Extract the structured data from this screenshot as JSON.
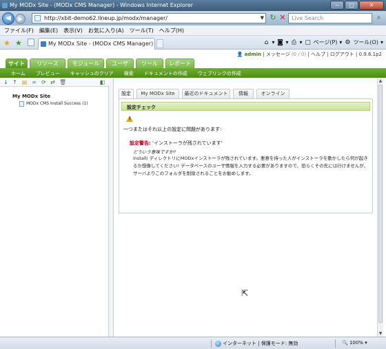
{
  "window": {
    "title": "My MODx Site - (MODx CMS Manager) - Windows Internet Explorer",
    "controls": {
      "minimize": "‒",
      "maximize": "□",
      "close": "✕"
    }
  },
  "address": {
    "url": "http://xbit-demo62.lineup.jp/modx/manager/",
    "search_placeholder": "Live Search"
  },
  "menu": [
    "ファイル(F)",
    "編集(E)",
    "表示(V)",
    "お気に入り(A)",
    "ツール(T)",
    "ヘルプ(H)"
  ],
  "browser_tab": {
    "title": "My MODx Site - (MODx CMS Manager)"
  },
  "command_bar": {
    "page": "ページ(P)",
    "tools": "ツール(O)"
  },
  "user_bar": {
    "username": "admin",
    "messages": "メッセージ",
    "message_count": "(0 / 0)",
    "help": "ヘルプ",
    "logout": "ログアウト",
    "version": "0.9.6.1p2"
  },
  "main_tabs": [
    "サイト",
    "リソース",
    "モジュール",
    "ユーザ",
    "ツール",
    "レポート"
  ],
  "sub_nav": [
    "ホーム",
    "プレビュー",
    "キャッシュのクリア",
    "検索",
    "ドキュメントの作成",
    "ウェブリンクの作成"
  ],
  "tree": {
    "root": "My MODx Site",
    "items": [
      {
        "label": "MODx CMS Install Success",
        "id": "(1)"
      }
    ]
  },
  "content_tabs": [
    "設定",
    "My MODx Site",
    "最近のドキュメント",
    "情報",
    "オンライン"
  ],
  "config_check": {
    "heading": "設定チェック",
    "summary": "一つまたはそれ以上の設定に問題があります:",
    "warning_label": "設定警告:",
    "warning_msg": "'インストーラが残されています'",
    "question": "どういう意味ですか?",
    "explanation": "install/ ディレクトリにMODxインストーラが残されています。悪意を持った人がインストーラを動かしたら何が起きるか想像してください! データベースのユーザ情報を入力する必要がありますので、恐らくその先には行けませんが、サーバよりこのフォルダを削除されることをお勧めします。"
  },
  "status": {
    "zone": "インターネット | 保護モード: 無効",
    "zoom": "100%"
  },
  "colors": {
    "accent_green": "#4d9a17",
    "warning_red": "#b8001a"
  }
}
